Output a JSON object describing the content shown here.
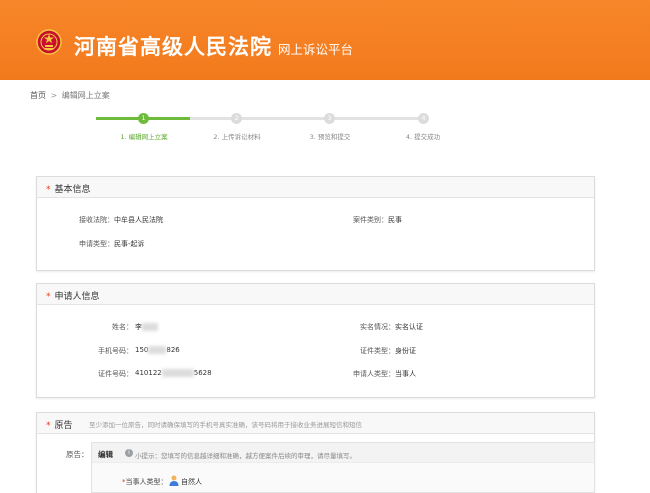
{
  "header": {
    "site_title": "河南省高级人民法院",
    "site_subtitle": "网上诉讼平台",
    "colors": {
      "brand": "#f27a1c",
      "accent_green": "#6ebb3c",
      "required_star": "#e8361c"
    }
  },
  "breadcrumb": {
    "home": "首页",
    "separator": ">",
    "current": "编辑网上立案"
  },
  "steps": [
    {
      "number": "1",
      "label": "1. 编辑网上立案",
      "active": true
    },
    {
      "number": "2",
      "label": "2. 上传诉讼材料",
      "active": false
    },
    {
      "number": "3",
      "label": "3. 预览和提交",
      "active": false
    },
    {
      "number": "4",
      "label": "4. 提交成功",
      "active": false
    }
  ],
  "basic_info": {
    "title": "基本信息",
    "court_label": "接收法院：",
    "court_value": "中牟县人民法院",
    "case_type_label": "案件类别：",
    "case_type_value": "民事",
    "apply_type_label": "申请类型：",
    "apply_type_value": "民事-起诉"
  },
  "applicant_info": {
    "title": "申请人信息",
    "name_label": "姓名：",
    "name_value": "李",
    "phone_label": "手机号码：",
    "phone_prefix": "150",
    "phone_suffix": "826",
    "id_label": "证件号码：",
    "id_prefix": "410122",
    "id_suffix": "5628",
    "verify_label": "实名情况：",
    "verify_value": "实名认证",
    "id_type_label": "证件类型：",
    "id_type_value": "身份证",
    "applicant_type_label": "申请人类型：",
    "applicant_type_value": "当事人"
  },
  "plaintiff": {
    "title": "原告",
    "hint": "至少添加一位原告，同时请确保填写的手机号真实准确，该号码将用于接收业务进展短信和短信",
    "row_label": "原告：",
    "edit_label": "编辑",
    "tip_icon": "info-icon",
    "tip_text": "小提示：您填写的信息越详细和准确，越方便案件后续的审理，请尽量填写。",
    "party_type_label": "当事人类型：",
    "party_type_value": "自然人",
    "party_icon": "person-icon"
  }
}
